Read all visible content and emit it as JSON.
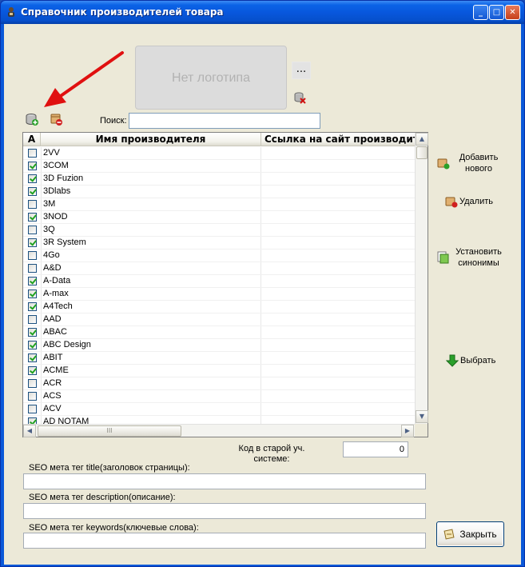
{
  "window": {
    "title": "Справочник производителей товара"
  },
  "logo": {
    "placeholder_text": "Нет логотипа",
    "browse_label": "..."
  },
  "search": {
    "label": "Поиск:",
    "value": ""
  },
  "grid": {
    "columns": {
      "active": "A",
      "name": "Имя производителя",
      "url": "Ссылка на сайт производител"
    },
    "rows": [
      {
        "name": "2VV",
        "checked": false
      },
      {
        "name": "3COM",
        "checked": true
      },
      {
        "name": "3D Fuzion",
        "checked": true
      },
      {
        "name": "3Dlabs",
        "checked": true
      },
      {
        "name": "3M",
        "checked": false
      },
      {
        "name": "3NOD",
        "checked": true
      },
      {
        "name": "3Q",
        "checked": false
      },
      {
        "name": "3R System",
        "checked": true
      },
      {
        "name": "4Go",
        "checked": false
      },
      {
        "name": "A&D",
        "checked": false
      },
      {
        "name": "A-Data",
        "checked": true
      },
      {
        "name": "A-max",
        "checked": true
      },
      {
        "name": "A4Tech",
        "checked": true
      },
      {
        "name": "AAD",
        "checked": false
      },
      {
        "name": "ABAC",
        "checked": true
      },
      {
        "name": "ABC Design",
        "checked": true
      },
      {
        "name": "ABIT",
        "checked": true
      },
      {
        "name": "ACME",
        "checked": true
      },
      {
        "name": "ACR",
        "checked": false
      },
      {
        "name": "ACS",
        "checked": false
      },
      {
        "name": "ACV",
        "checked": false
      },
      {
        "name": "AD NOTAM",
        "checked": true
      }
    ],
    "hscroll_grip": "III"
  },
  "side": {
    "add_label": "Добавить нового",
    "delete_label": "Удалить",
    "synonyms_label": "Установить синонимы",
    "select_label": "Выбрать"
  },
  "form": {
    "old_code_label": "Код в старой уч. системе:",
    "old_code_value": "0",
    "seo_title_label": "SEO мета тег title(заголовок страницы):",
    "seo_description_label": "SEO мета тег description(описание):",
    "seo_keywords_label": "SEO мета тег keywords(ключевые слова):",
    "seo_title_value": "",
    "seo_description_value": "",
    "seo_keywords_value": ""
  },
  "close_label": "Закрыть",
  "colors": {
    "title_bar": "#0857dd",
    "client_bg": "#ece9d8",
    "arrow": "#e01010",
    "check": "#21a121"
  }
}
